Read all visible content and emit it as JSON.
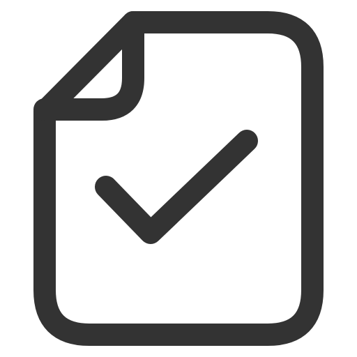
{
  "icon": {
    "name": "file-check-icon",
    "color": "#333333",
    "background": "#ffffff"
  }
}
